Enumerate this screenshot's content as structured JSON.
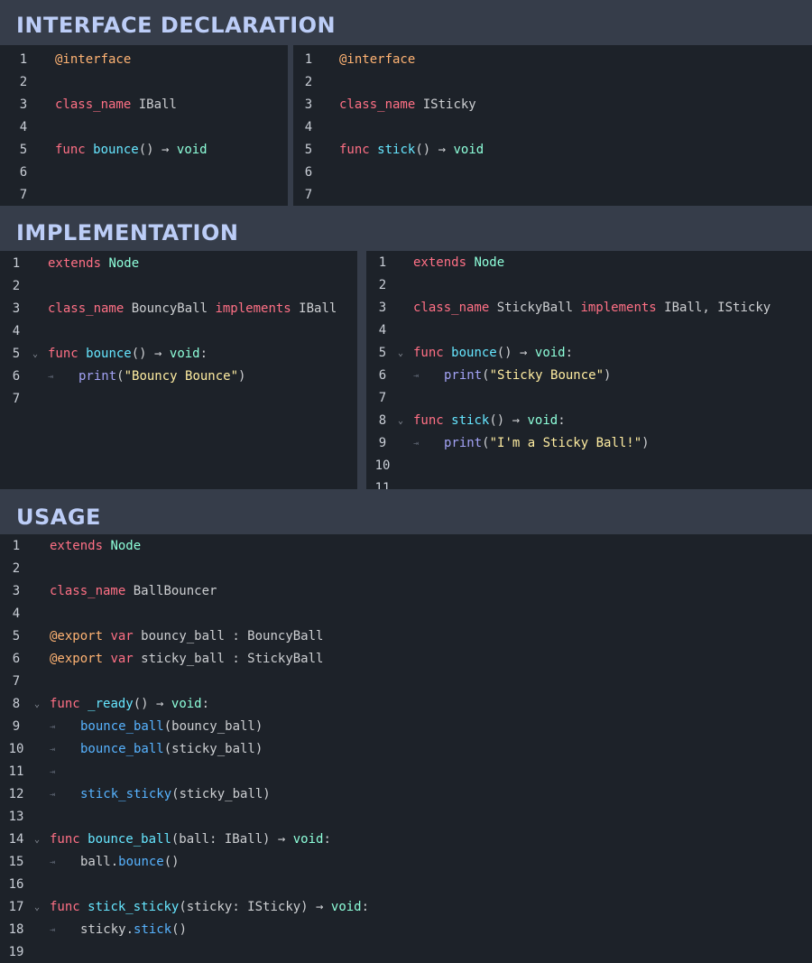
{
  "sections": {
    "interface_title": "INTERFACE DECLARATION",
    "implementation_title": "IMPLEMENTATION",
    "usage_title": "USAGE"
  },
  "panels": [
    {
      "id": "iball",
      "lines": [
        [
          {
            "c": "dec",
            "t": "@interface"
          }
        ],
        [],
        [
          {
            "c": "kw",
            "t": "class_name"
          },
          {
            "c": "txt",
            "t": " IBall"
          }
        ],
        [],
        [
          {
            "c": "kw",
            "t": "func"
          },
          {
            "c": "txt",
            "t": " "
          },
          {
            "c": "fn2",
            "t": "bounce"
          },
          {
            "c": "txt",
            "t": "() → "
          },
          {
            "c": "type",
            "t": "void"
          }
        ],
        [],
        []
      ]
    },
    {
      "id": "isticky",
      "lines": [
        [
          {
            "c": "dec",
            "t": "@interface"
          }
        ],
        [],
        [
          {
            "c": "kw",
            "t": "class_name"
          },
          {
            "c": "txt",
            "t": " ISticky"
          }
        ],
        [],
        [
          {
            "c": "kw",
            "t": "func"
          },
          {
            "c": "txt",
            "t": " "
          },
          {
            "c": "fn2",
            "t": "stick"
          },
          {
            "c": "txt",
            "t": "() → "
          },
          {
            "c": "type",
            "t": "void"
          }
        ],
        [],
        []
      ]
    },
    {
      "id": "bouncyball",
      "folds": [
        5
      ],
      "tabs": [
        6
      ],
      "lines": [
        [
          {
            "c": "kw",
            "t": "extends"
          },
          {
            "c": "txt",
            "t": " "
          },
          {
            "c": "type",
            "t": "Node"
          }
        ],
        [],
        [
          {
            "c": "kw",
            "t": "class_name"
          },
          {
            "c": "txt",
            "t": " BouncyBall "
          },
          {
            "c": "kw",
            "t": "implements"
          },
          {
            "c": "txt",
            "t": " IBall"
          }
        ],
        [],
        [
          {
            "c": "kw",
            "t": "func"
          },
          {
            "c": "txt",
            "t": " "
          },
          {
            "c": "fn2",
            "t": "bounce"
          },
          {
            "c": "txt",
            "t": "() → "
          },
          {
            "c": "type",
            "t": "void"
          },
          {
            "c": "txt",
            "t": ":"
          }
        ],
        [
          {
            "c": "bi",
            "t": "print"
          },
          {
            "c": "txt",
            "t": "("
          },
          {
            "c": "str",
            "t": "\"Bouncy Bounce\""
          },
          {
            "c": "txt",
            "t": ")"
          }
        ],
        []
      ]
    },
    {
      "id": "stickyball",
      "folds": [
        5,
        8
      ],
      "tabs": [
        6,
        9
      ],
      "lines": [
        [
          {
            "c": "kw",
            "t": "extends"
          },
          {
            "c": "txt",
            "t": " "
          },
          {
            "c": "type",
            "t": "Node"
          }
        ],
        [],
        [
          {
            "c": "kw",
            "t": "class_name"
          },
          {
            "c": "txt",
            "t": " StickyBall "
          },
          {
            "c": "kw",
            "t": "implements"
          },
          {
            "c": "txt",
            "t": " IBall, ISticky"
          }
        ],
        [],
        [
          {
            "c": "kw",
            "t": "func"
          },
          {
            "c": "txt",
            "t": " "
          },
          {
            "c": "fn2",
            "t": "bounce"
          },
          {
            "c": "txt",
            "t": "() → "
          },
          {
            "c": "type",
            "t": "void"
          },
          {
            "c": "txt",
            "t": ":"
          }
        ],
        [
          {
            "c": "bi",
            "t": "print"
          },
          {
            "c": "txt",
            "t": "("
          },
          {
            "c": "str",
            "t": "\"Sticky Bounce\""
          },
          {
            "c": "txt",
            "t": ")"
          }
        ],
        [],
        [
          {
            "c": "kw",
            "t": "func"
          },
          {
            "c": "txt",
            "t": " "
          },
          {
            "c": "fn2",
            "t": "stick"
          },
          {
            "c": "txt",
            "t": "() → "
          },
          {
            "c": "type",
            "t": "void"
          },
          {
            "c": "txt",
            "t": ":"
          }
        ],
        [
          {
            "c": "bi",
            "t": "print"
          },
          {
            "c": "txt",
            "t": "("
          },
          {
            "c": "str",
            "t": "\"I'm a Sticky Ball!\""
          },
          {
            "c": "txt",
            "t": ")"
          }
        ],
        [],
        []
      ]
    },
    {
      "id": "usage",
      "folds": [
        8,
        14,
        17
      ],
      "tabs": [
        9,
        10,
        11,
        12,
        15,
        18
      ],
      "lines": [
        [
          {
            "c": "kw",
            "t": "extends"
          },
          {
            "c": "txt",
            "t": " "
          },
          {
            "c": "type",
            "t": "Node"
          }
        ],
        [],
        [
          {
            "c": "kw",
            "t": "class_name"
          },
          {
            "c": "txt",
            "t": " BallBouncer"
          }
        ],
        [],
        [
          {
            "c": "dec",
            "t": "@export"
          },
          {
            "c": "txt",
            "t": " "
          },
          {
            "c": "kw",
            "t": "var"
          },
          {
            "c": "txt",
            "t": " bouncy_ball : BouncyBall"
          }
        ],
        [
          {
            "c": "dec",
            "t": "@export"
          },
          {
            "c": "txt",
            "t": " "
          },
          {
            "c": "kw",
            "t": "var"
          },
          {
            "c": "txt",
            "t": " sticky_ball : StickyBall"
          }
        ],
        [],
        [
          {
            "c": "kw",
            "t": "func"
          },
          {
            "c": "txt",
            "t": " "
          },
          {
            "c": "fn2",
            "t": "_ready"
          },
          {
            "c": "txt",
            "t": "() → "
          },
          {
            "c": "type",
            "t": "void"
          },
          {
            "c": "txt",
            "t": ":"
          }
        ],
        [
          {
            "c": "fn",
            "t": "bounce_ball"
          },
          {
            "c": "txt",
            "t": "(bouncy_ball)"
          }
        ],
        [
          {
            "c": "fn",
            "t": "bounce_ball"
          },
          {
            "c": "txt",
            "t": "(sticky_ball)"
          }
        ],
        [],
        [
          {
            "c": "fn",
            "t": "stick_sticky"
          },
          {
            "c": "txt",
            "t": "(sticky_ball)"
          }
        ],
        [],
        [
          {
            "c": "kw",
            "t": "func"
          },
          {
            "c": "txt",
            "t": " "
          },
          {
            "c": "fn2",
            "t": "bounce_ball"
          },
          {
            "c": "txt",
            "t": "(ball: IBall) → "
          },
          {
            "c": "type",
            "t": "void"
          },
          {
            "c": "txt",
            "t": ":"
          }
        ],
        [
          {
            "c": "txt",
            "t": "ball."
          },
          {
            "c": "fn",
            "t": "bounce"
          },
          {
            "c": "txt",
            "t": "()"
          }
        ],
        [],
        [
          {
            "c": "kw",
            "t": "func"
          },
          {
            "c": "txt",
            "t": " "
          },
          {
            "c": "fn2",
            "t": "stick_sticky"
          },
          {
            "c": "txt",
            "t": "(sticky: ISticky) → "
          },
          {
            "c": "type",
            "t": "void"
          },
          {
            "c": "txt",
            "t": ":"
          }
        ],
        [
          {
            "c": "txt",
            "t": "sticky."
          },
          {
            "c": "fn",
            "t": "stick"
          },
          {
            "c": "txt",
            "t": "()"
          }
        ],
        []
      ]
    }
  ],
  "icons": {
    "fold": "chevron-down-icon",
    "tab": "tab-indent-icon"
  }
}
